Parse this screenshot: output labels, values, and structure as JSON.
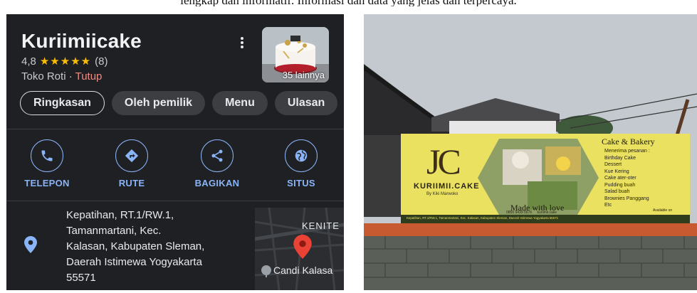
{
  "caption_top": "lengkap dan informatif. Informasi dan data yang jelas dan terpercaya.",
  "maps": {
    "business_name": "Kuriimiicake",
    "rating": "4,8",
    "stars": "★★★★★",
    "review_count": "(8)",
    "category": "Toko Roti",
    "separator": " · ",
    "status": "Tutup",
    "photo_more": "35 lainnya",
    "tabs": [
      {
        "label": "Ringkasan"
      },
      {
        "label": "Oleh pemilik"
      },
      {
        "label": "Menu"
      },
      {
        "label": "Ulasan"
      }
    ],
    "actions": [
      {
        "label": "TELEPON",
        "icon": "phone-icon"
      },
      {
        "label": "RUTE",
        "icon": "directions-icon"
      },
      {
        "label": "BAGIKAN",
        "icon": "share-icon"
      },
      {
        "label": "SITUS",
        "icon": "globe-icon"
      }
    ],
    "address_lines": [
      "Kepatihan, RT.1/RW.1,",
      "Tamanmartani, Kec.",
      "Kalasan, Kabupaten Sleman,",
      "Daerah Istimewa Yogyakarta",
      "55571"
    ],
    "map_labels": {
      "top": "KENITE",
      "bottom": "Candi Kalasa"
    },
    "colors": {
      "accent": "#8ab4f8",
      "star": "#fbbc04",
      "closed": "#f28b82",
      "pin": "#ea4335",
      "background": "#1f2023"
    }
  },
  "photo": {
    "banner": {
      "logo_letters": "JC",
      "brand": "KURIIMII.CAKE",
      "by_line": "By Kiki Marwoko",
      "tagline": "Made with love",
      "heading": "Cake & Bakery",
      "menu_items": [
        "Menerima pesanan :",
        "Birthday Cake",
        "Dessert",
        "Kue Kering",
        "Cake ater-oter",
        "Pudding buah",
        "Salad buah",
        "Brownies Panggang",
        "Etc"
      ],
      "phone": "0856 9439 5676",
      "instagram": "kuriimii.cake",
      "footer_address": "Kepatihan, RT.1/RW.1, Tamanmartani, Kec. Kalasan, Kabupaten Sleman, Daerah Istimewa Yogyakarta 55571",
      "available_on": "Available on"
    }
  }
}
